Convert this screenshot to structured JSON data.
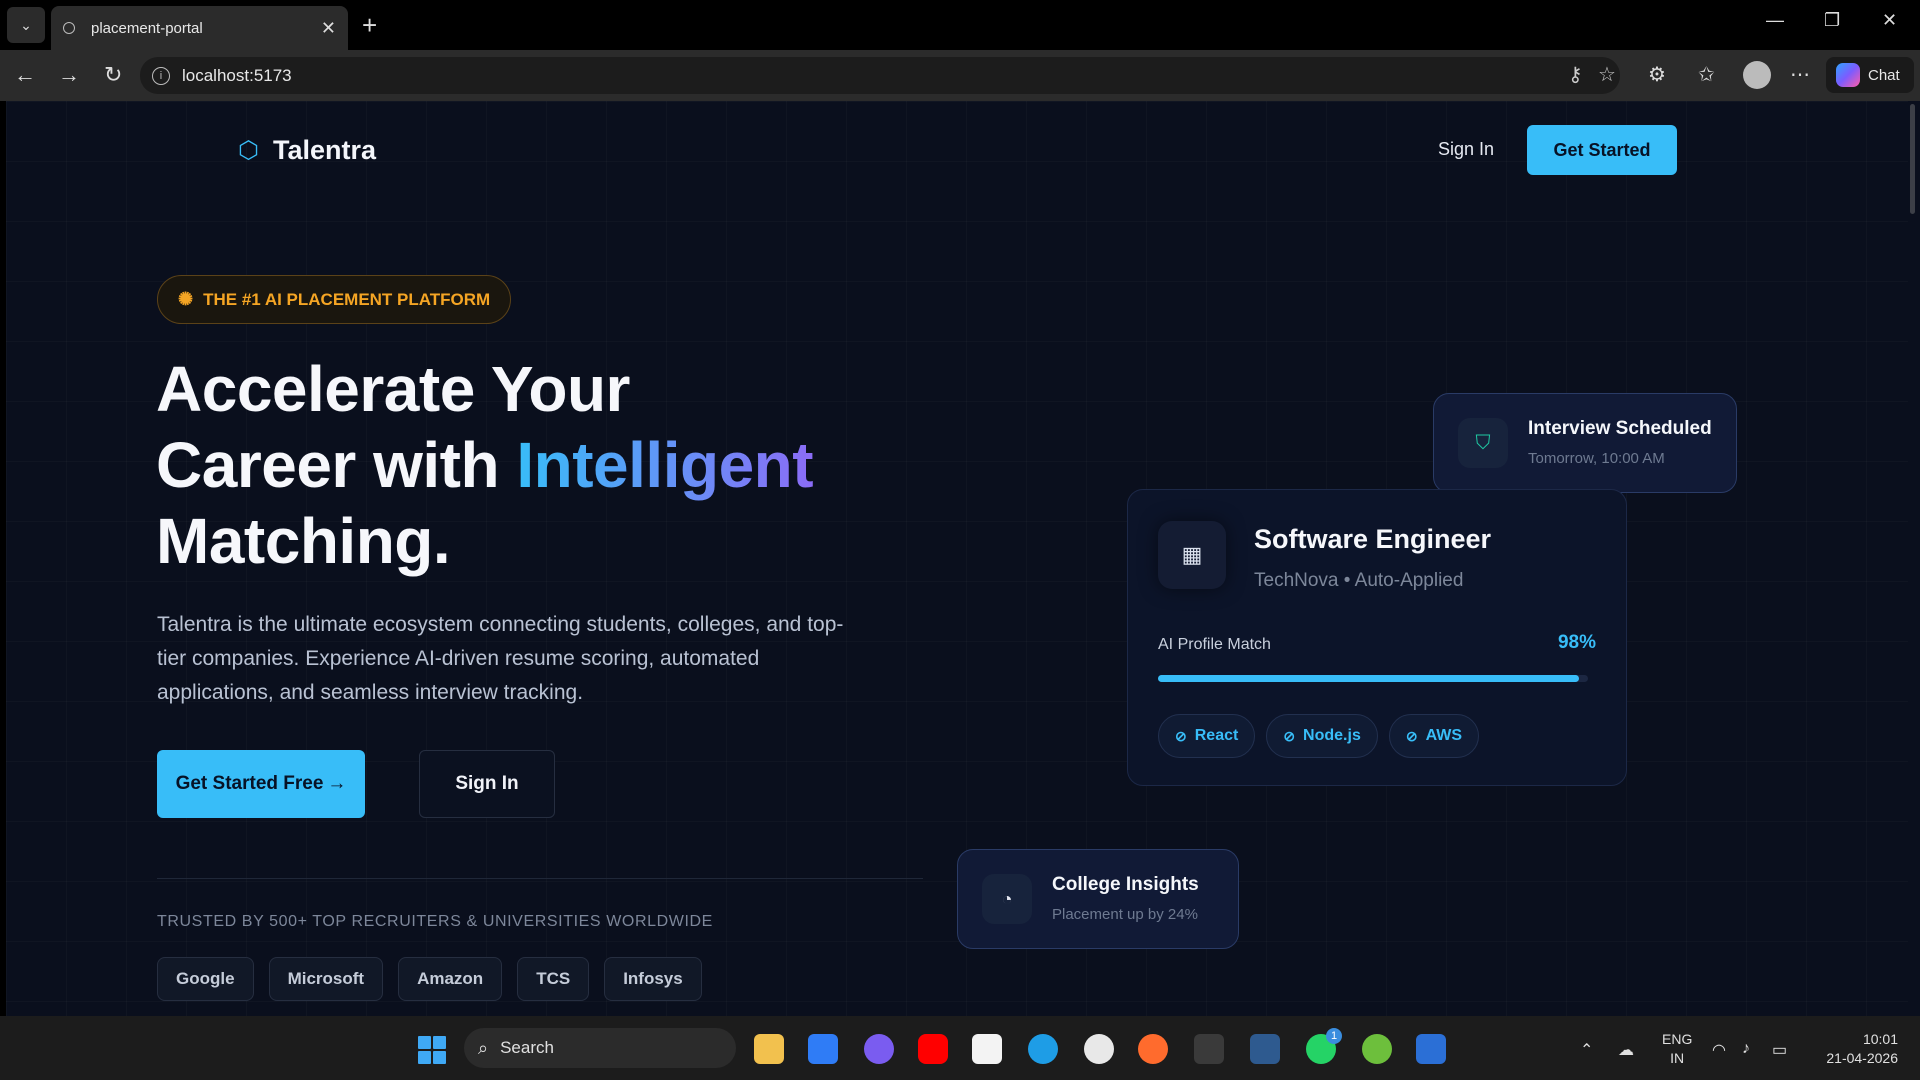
{
  "browser": {
    "tab_title": "placement-portal",
    "tab_close": "✕",
    "new_tab": "+",
    "url": "localhost:5173",
    "chat_label": "Chat",
    "icons": [
      "back-icon",
      "forward-icon",
      "refresh-icon",
      "info-icon",
      "key-icon",
      "star-icon",
      "extensions-icon",
      "favorites-icon",
      "profile-icon",
      "more-icon"
    ]
  },
  "nav": {
    "brand": "Talentra",
    "sign_in": "Sign In",
    "get_started": "Get Started"
  },
  "hero": {
    "badge": "THE #1 AI PLACEMENT PLATFORM",
    "headline_1": "Accelerate Your",
    "headline_2a": "Career with ",
    "headline_2b": "Intelligent",
    "headline_3": "Matching.",
    "lede": "Talentra is the ultimate ecosystem connecting students, colleges, and top-tier companies. Experience AI-driven resume scoring, automated applications, and seamless interview tracking.",
    "cta_primary": "Get Started Free",
    "cta_secondary": "Sign In",
    "trusted": "TRUSTED BY 500+ TOP RECRUITERS & UNIVERSITIES WORLDWIDE",
    "logos": [
      "Google",
      "Microsoft",
      "Amazon",
      "TCS",
      "Infosys"
    ]
  },
  "cards": {
    "interview": {
      "title": "Interview Scheduled",
      "subtitle": "Tomorrow, 10:00 AM"
    },
    "job": {
      "title": "Software Engineer",
      "subtitle": "TechNova • Auto-Applied",
      "match_label": "AI Profile Match",
      "match_pct": "98%",
      "match_value": 0.98,
      "tags": [
        "React",
        "Node.js",
        "AWS"
      ]
    },
    "college": {
      "title": "College Insights",
      "subtitle": "Placement up by 24%"
    }
  },
  "taskbar": {
    "search": "Search",
    "lang_1": "ENG",
    "lang_2": "IN",
    "time": "10:01",
    "date": "21-04-2026",
    "whatsapp_badge": "1"
  },
  "colors": {
    "accent": "#38bdf8",
    "accent_purple": "#8b6cf6",
    "badge": "#f5a524",
    "page_bg": "#0a0f1d"
  }
}
